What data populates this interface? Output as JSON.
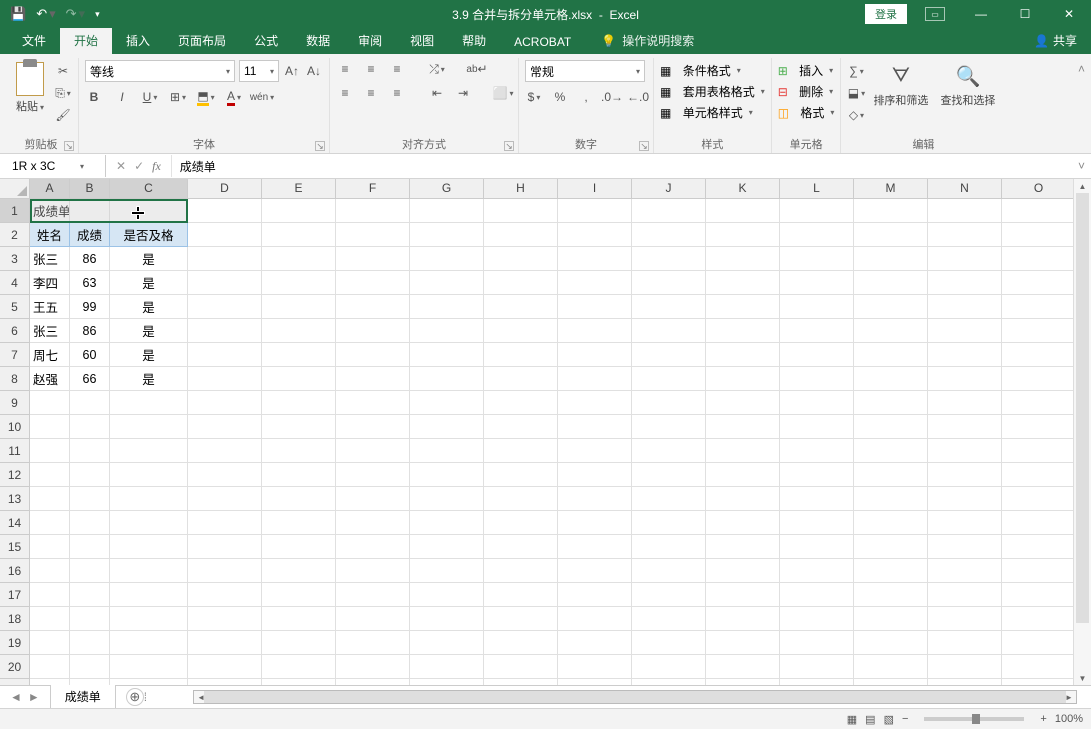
{
  "titlebar": {
    "filename": "3.9 合并与拆分单元格.xlsx",
    "appname": "Excel",
    "login": "登录"
  },
  "tabs": {
    "file": "文件",
    "home": "开始",
    "insert": "插入",
    "layout": "页面布局",
    "formulas": "公式",
    "data": "数据",
    "review": "审阅",
    "view": "视图",
    "help": "帮助",
    "acrobat": "ACROBAT",
    "tellme": "操作说明搜索",
    "share": "共享"
  },
  "ribbon": {
    "clipboard": {
      "paste": "粘贴",
      "label": "剪贴板"
    },
    "font": {
      "name": "等线",
      "size": "11",
      "label": "字体"
    },
    "alignment": {
      "label": "对齐方式"
    },
    "number": {
      "format": "常规",
      "label": "数字"
    },
    "styles": {
      "cond": "条件格式",
      "table": "套用表格格式",
      "cell": "单元格样式",
      "label": "样式"
    },
    "cells": {
      "insert": "插入",
      "delete": "删除",
      "format": "格式",
      "label": "单元格"
    },
    "editing": {
      "sort": "排序和筛选",
      "find": "查找和选择",
      "label": "编辑"
    }
  },
  "formulabar": {
    "namebox": "1R x 3C",
    "content": "成绩单"
  },
  "columns": [
    "A",
    "B",
    "C",
    "D",
    "E",
    "F",
    "G",
    "H",
    "I",
    "J",
    "K",
    "L",
    "M",
    "N",
    "O"
  ],
  "rows": 22,
  "data": {
    "r1": {
      "A": "成绩单"
    },
    "r2": {
      "A": "姓名",
      "B": "成绩",
      "C": "是否及格"
    },
    "r3": {
      "A": "张三",
      "B": "86",
      "C": "是"
    },
    "r4": {
      "A": "李四",
      "B": "63",
      "C": "是"
    },
    "r5": {
      "A": "王五",
      "B": "99",
      "C": "是"
    },
    "r6": {
      "A": "张三",
      "B": "86",
      "C": "是"
    },
    "r7": {
      "A": "周七",
      "B": "60",
      "C": "是"
    },
    "r8": {
      "A": "赵强",
      "B": "66",
      "C": "是"
    }
  },
  "sheet": {
    "name": "成绩单"
  },
  "status": {
    "zoom": "100%"
  }
}
